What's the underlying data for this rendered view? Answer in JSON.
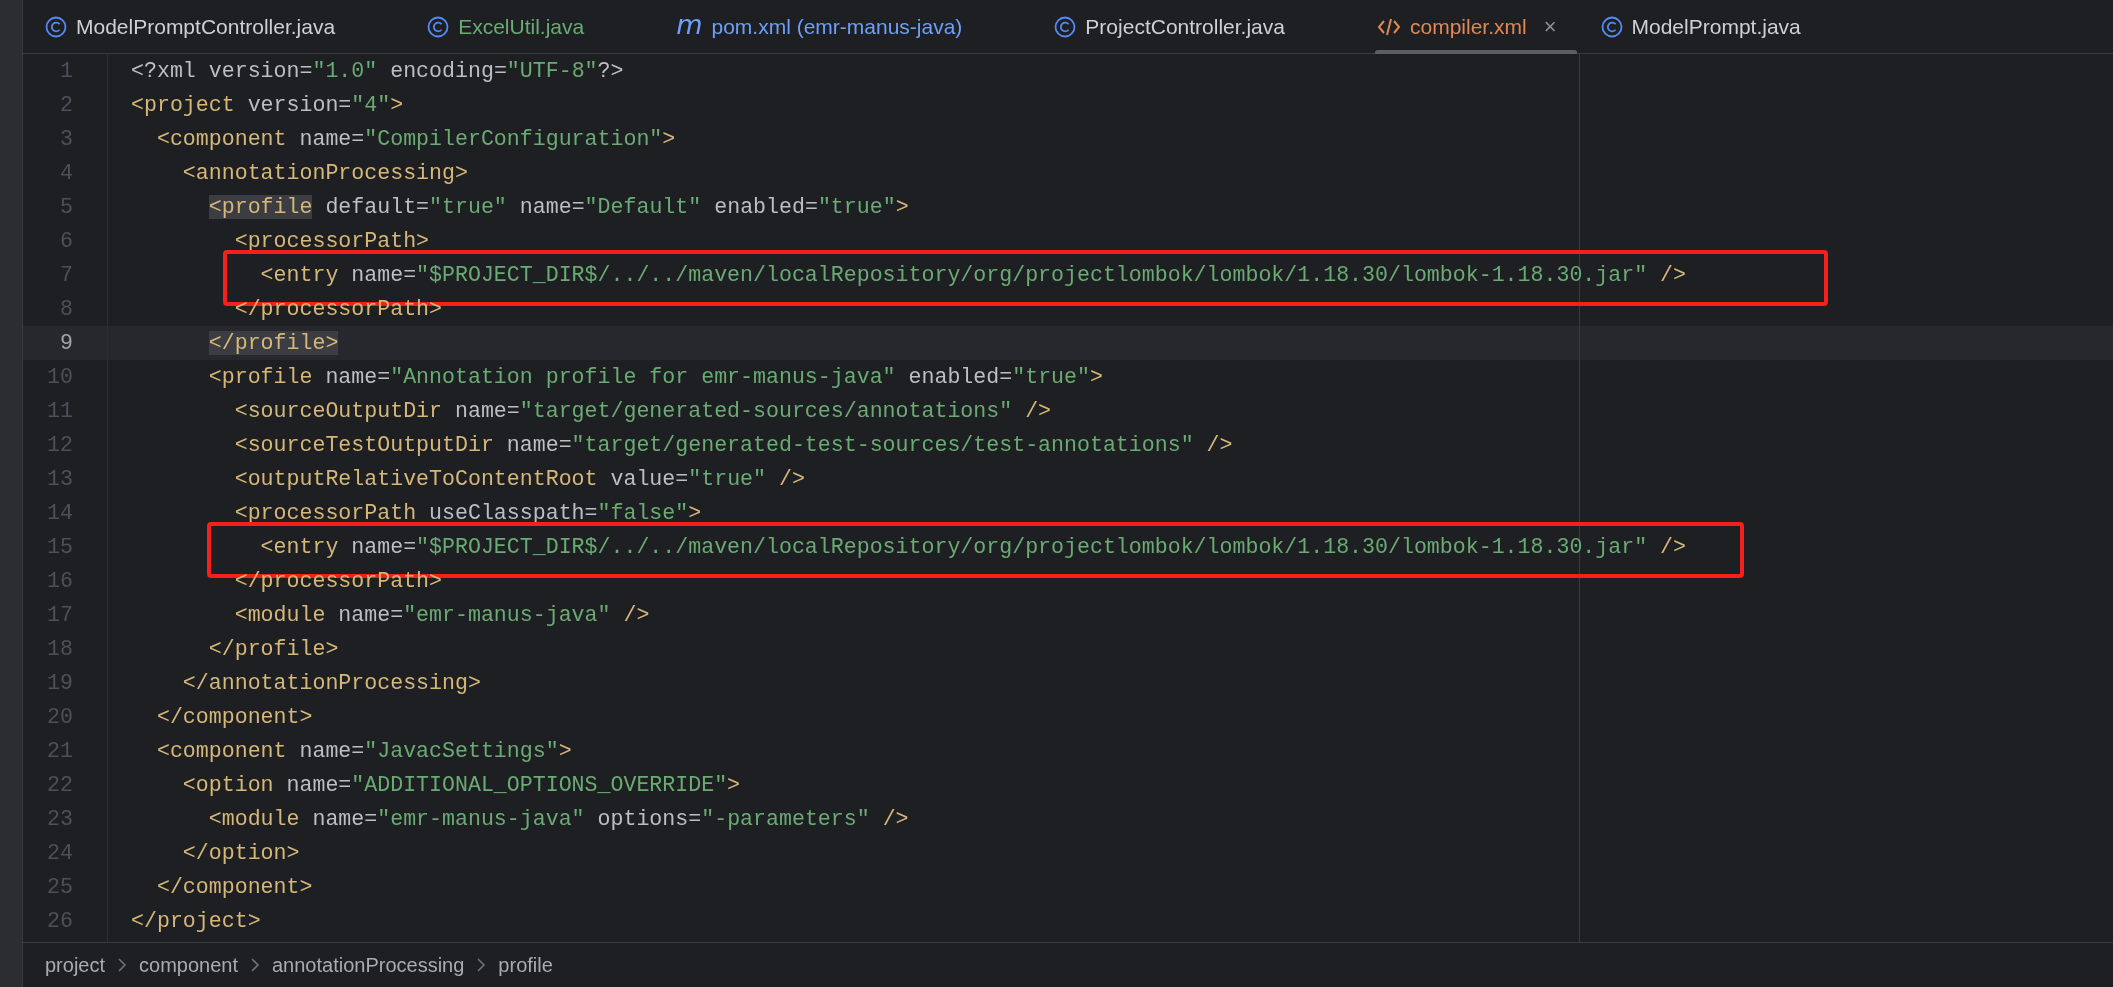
{
  "tabs": [
    {
      "label": "ModelPromptController.java",
      "kind": "class",
      "color": "#cdd0d6",
      "selected": false
    },
    {
      "label": "ExcelUtil.java",
      "kind": "class",
      "color": "#6aab73",
      "selected": false
    },
    {
      "label": "pom.xml (emr-manus-java)",
      "kind": "maven",
      "icon_text": "m",
      "color": "#6f9ff8",
      "selected": false
    },
    {
      "label": "ProjectController.java",
      "kind": "class",
      "color": "#cdd0d6",
      "selected": false
    },
    {
      "label": "compiler.xml",
      "kind": "xml",
      "color": "#e08855",
      "selected": true,
      "close": "×"
    },
    {
      "label": "ModelPrompt.java",
      "kind": "class",
      "color": "#cdd0d6",
      "selected": false
    }
  ],
  "lines": [
    {
      "number": "1",
      "current": false,
      "framed": false,
      "tokens": [
        {
          "kind": "text",
          "text": "<?xml"
        },
        {
          "kind": "attr",
          "text": " version"
        },
        {
          "kind": "text",
          "text": "="
        },
        {
          "kind": "value",
          "text": "\"1.0\""
        },
        {
          "kind": "attr",
          "text": " encoding"
        },
        {
          "kind": "text",
          "text": "="
        },
        {
          "kind": "value",
          "text": "\"UTF-8\""
        },
        {
          "kind": "text",
          "text": "?>"
        }
      ]
    },
    {
      "number": "2",
      "current": false,
      "framed": false,
      "tokens": [
        {
          "kind": "tag",
          "text": "<project"
        },
        {
          "kind": "attr",
          "text": " version"
        },
        {
          "kind": "text",
          "text": "="
        },
        {
          "kind": "value",
          "text": "\"4\""
        },
        {
          "kind": "tag",
          "text": ">"
        }
      ]
    },
    {
      "number": "3",
      "current": false,
      "framed": false,
      "tokens": [
        {
          "kind": "tag",
          "text": "  <component"
        },
        {
          "kind": "attr",
          "text": " name"
        },
        {
          "kind": "text",
          "text": "="
        },
        {
          "kind": "value",
          "text": "\"CompilerConfiguration\""
        },
        {
          "kind": "tag",
          "text": ">"
        }
      ]
    },
    {
      "number": "4",
      "current": false,
      "framed": false,
      "tokens": [
        {
          "kind": "tag",
          "text": "    <annotationProcessing>"
        }
      ]
    },
    {
      "number": "5",
      "current": false,
      "framed": false,
      "tokens": [
        {
          "kind": "tag",
          "text": "      <profile",
          "match": true
        },
        {
          "kind": "attr",
          "text": " default"
        },
        {
          "kind": "text",
          "text": "="
        },
        {
          "kind": "value",
          "text": "\"true\""
        },
        {
          "kind": "attr",
          "text": " name"
        },
        {
          "kind": "text",
          "text": "="
        },
        {
          "kind": "value",
          "text": "\"Default\""
        },
        {
          "kind": "attr",
          "text": " enabled"
        },
        {
          "kind": "text",
          "text": "="
        },
        {
          "kind": "value",
          "text": "\"true\""
        },
        {
          "kind": "tag",
          "text": ">"
        }
      ]
    },
    {
      "number": "6",
      "current": false,
      "framed": false,
      "tokens": [
        {
          "kind": "tag",
          "text": "        <processorPath>"
        }
      ]
    },
    {
      "number": "7",
      "current": false,
      "framed": true,
      "tokens": [
        {
          "kind": "tag",
          "text": "          <entry"
        },
        {
          "kind": "attr",
          "text": " name"
        },
        {
          "kind": "text",
          "text": "="
        },
        {
          "kind": "value",
          "text": "\"$PROJECT_DIR$/../../maven/localRepository/org/projectlombok/lombok/1.18.30/lombok-1.18.30.jar\""
        },
        {
          "kind": "tag",
          "text": " />"
        }
      ]
    },
    {
      "number": "8",
      "current": false,
      "framed": false,
      "tokens": [
        {
          "kind": "tag",
          "text": "        </processorPath>"
        }
      ]
    },
    {
      "number": "9",
      "current": true,
      "framed": false,
      "tokens": [
        {
          "kind": "tag",
          "text": "      </profile>",
          "match": true
        }
      ]
    },
    {
      "number": "10",
      "current": false,
      "framed": false,
      "tokens": [
        {
          "kind": "tag",
          "text": "      <profile"
        },
        {
          "kind": "attr",
          "text": " name"
        },
        {
          "kind": "text",
          "text": "="
        },
        {
          "kind": "value",
          "text": "\"Annotation profile for emr-manus-java\""
        },
        {
          "kind": "attr",
          "text": " enabled"
        },
        {
          "kind": "text",
          "text": "="
        },
        {
          "kind": "value",
          "text": "\"true\""
        },
        {
          "kind": "tag",
          "text": ">"
        }
      ]
    },
    {
      "number": "11",
      "current": false,
      "framed": false,
      "tokens": [
        {
          "kind": "tag",
          "text": "        <sourceOutputDir"
        },
        {
          "kind": "attr",
          "text": " name"
        },
        {
          "kind": "text",
          "text": "="
        },
        {
          "kind": "value",
          "text": "\"target/generated-sources/annotations\""
        },
        {
          "kind": "tag",
          "text": " />"
        }
      ]
    },
    {
      "number": "12",
      "current": false,
      "framed": false,
      "tokens": [
        {
          "kind": "tag",
          "text": "        <sourceTestOutputDir"
        },
        {
          "kind": "attr",
          "text": " name"
        },
        {
          "kind": "text",
          "text": "="
        },
        {
          "kind": "value",
          "text": "\"target/generated-test-sources/test-annotations\""
        },
        {
          "kind": "tag",
          "text": " />"
        }
      ]
    },
    {
      "number": "13",
      "current": false,
      "framed": false,
      "tokens": [
        {
          "kind": "tag",
          "text": "        <outputRelativeToContentRoot"
        },
        {
          "kind": "attr",
          "text": " value"
        },
        {
          "kind": "text",
          "text": "="
        },
        {
          "kind": "value",
          "text": "\"true\""
        },
        {
          "kind": "tag",
          "text": " />"
        }
      ]
    },
    {
      "number": "14",
      "current": false,
      "framed": false,
      "tokens": [
        {
          "kind": "tag",
          "text": "        <processorPath"
        },
        {
          "kind": "attr",
          "text": " useClasspath"
        },
        {
          "kind": "text",
          "text": "="
        },
        {
          "kind": "value",
          "text": "\"false\""
        },
        {
          "kind": "tag",
          "text": ">"
        }
      ]
    },
    {
      "number": "15",
      "current": false,
      "framed": true,
      "tokens": [
        {
          "kind": "tag",
          "text": "          <entry"
        },
        {
          "kind": "attr",
          "text": " name"
        },
        {
          "kind": "text",
          "text": "="
        },
        {
          "kind": "value",
          "text": "\"$PROJECT_DIR$/../../maven/localRepository/org/projectlombok/lombok/1.18.30/lombok-1.18.30.jar\""
        },
        {
          "kind": "tag",
          "text": " />"
        }
      ]
    },
    {
      "number": "16",
      "current": false,
      "framed": false,
      "tokens": [
        {
          "kind": "tag",
          "text": "        </processorPath>"
        }
      ]
    },
    {
      "number": "17",
      "current": false,
      "framed": false,
      "tokens": [
        {
          "kind": "tag",
          "text": "        <module"
        },
        {
          "kind": "attr",
          "text": " name"
        },
        {
          "kind": "text",
          "text": "="
        },
        {
          "kind": "value",
          "text": "\"emr-manus-java\""
        },
        {
          "kind": "tag",
          "text": " />"
        }
      ]
    },
    {
      "number": "18",
      "current": false,
      "framed": false,
      "tokens": [
        {
          "kind": "tag",
          "text": "      </profile>"
        }
      ]
    },
    {
      "number": "19",
      "current": false,
      "framed": false,
      "tokens": [
        {
          "kind": "tag",
          "text": "    </annotationProcessing>"
        }
      ]
    },
    {
      "number": "20",
      "current": false,
      "framed": false,
      "tokens": [
        {
          "kind": "tag",
          "text": "  </component>"
        }
      ]
    },
    {
      "number": "21",
      "current": false,
      "framed": false,
      "tokens": [
        {
          "kind": "tag",
          "text": "  <component"
        },
        {
          "kind": "attr",
          "text": " name"
        },
        {
          "kind": "text",
          "text": "="
        },
        {
          "kind": "value",
          "text": "\"JavacSettings\""
        },
        {
          "kind": "tag",
          "text": ">"
        }
      ]
    },
    {
      "number": "22",
      "current": false,
      "framed": false,
      "tokens": [
        {
          "kind": "tag",
          "text": "    <option"
        },
        {
          "kind": "attr",
          "text": " name"
        },
        {
          "kind": "text",
          "text": "="
        },
        {
          "kind": "value",
          "text": "\"ADDITIONAL_OPTIONS_OVERRIDE\""
        },
        {
          "kind": "tag",
          "text": ">"
        }
      ]
    },
    {
      "number": "23",
      "current": false,
      "framed": false,
      "tokens": [
        {
          "kind": "tag",
          "text": "      <module"
        },
        {
          "kind": "attr",
          "text": " name"
        },
        {
          "kind": "text",
          "text": "="
        },
        {
          "kind": "value",
          "text": "\"emr-manus-java\""
        },
        {
          "kind": "attr",
          "text": " options"
        },
        {
          "kind": "text",
          "text": "="
        },
        {
          "kind": "value",
          "text": "\"-parameters\""
        },
        {
          "kind": "tag",
          "text": " />"
        }
      ]
    },
    {
      "number": "24",
      "current": false,
      "framed": false,
      "tokens": [
        {
          "kind": "tag",
          "text": "    </option>"
        }
      ]
    },
    {
      "number": "25",
      "current": false,
      "framed": false,
      "tokens": [
        {
          "kind": "tag",
          "text": "  </component>"
        }
      ]
    },
    {
      "number": "26",
      "current": false,
      "framed": false,
      "tokens": [
        {
          "kind": "tag",
          "text": "</project>"
        }
      ]
    }
  ],
  "breadcrumbs": [
    "project",
    "component",
    "annotationProcessing",
    "profile"
  ]
}
